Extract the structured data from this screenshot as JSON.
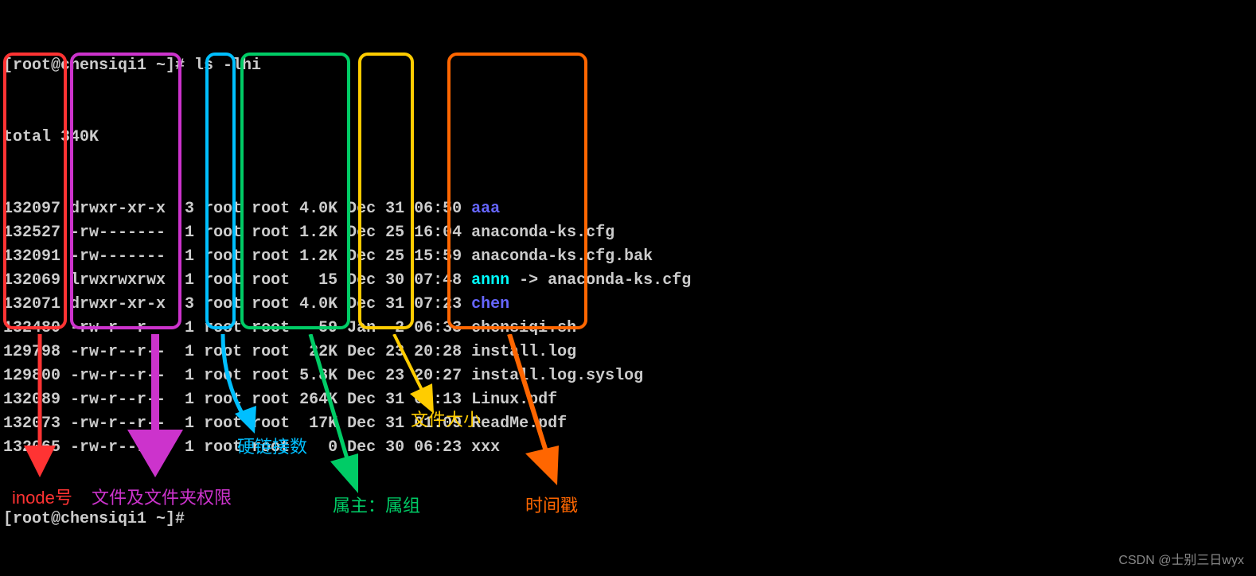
{
  "prompt1": "[root@chensiqi1 ~]# ls -lhi",
  "total": "total 340K",
  "prompt2": "[root@chensiqi1 ~]# ",
  "rows": [
    {
      "inode": "132097",
      "perm": "drwxr-xr-x",
      "links": "3",
      "owner": "root root",
      "size": "4.0K",
      "date": "Dec 31 06:50",
      "fname": "aaa",
      "class": "blue-dir",
      "extra": ""
    },
    {
      "inode": "132527",
      "perm": "-rw-------",
      "links": "1",
      "owner": "root root",
      "size": "1.2K",
      "date": "Dec 25 16:04",
      "fname": "anaconda-ks.cfg",
      "class": "fname",
      "extra": ""
    },
    {
      "inode": "132091",
      "perm": "-rw-------",
      "links": "1",
      "owner": "root root",
      "size": "1.2K",
      "date": "Dec 25 15:59",
      "fname": "anaconda-ks.cfg.bak",
      "class": "fname",
      "extra": ""
    },
    {
      "inode": "132069",
      "perm": "lrwxrwxrwx",
      "links": "1",
      "owner": "root root",
      "size": "  15",
      "date": "Dec 30 07:48",
      "fname": "annn",
      "class": "cyan-link",
      "extra": " -> anaconda-ks.cfg"
    },
    {
      "inode": "132071",
      "perm": "drwxr-xr-x",
      "links": "3",
      "owner": "root root",
      "size": "4.0K",
      "date": "Dec 31 07:23",
      "fname": "chen",
      "class": "blue-dir",
      "extra": ""
    },
    {
      "inode": "132480",
      "perm": "-rw-r--r--",
      "links": "1",
      "owner": "root root",
      "size": "  59",
      "date": "Jan  2 06:33",
      "fname": "chensiqi.sh",
      "class": "fname",
      "extra": ""
    },
    {
      "inode": "129798",
      "perm": "-rw-r--r--",
      "links": "1",
      "owner": "root root",
      "size": " 22K",
      "date": "Dec 23 20:28",
      "fname": "install.log",
      "class": "fname",
      "extra": ""
    },
    {
      "inode": "129800",
      "perm": "-rw-r--r--",
      "links": "1",
      "owner": "root root",
      "size": "5.8K",
      "date": "Dec 23 20:27",
      "fname": "install.log.syslog",
      "class": "fname",
      "extra": ""
    },
    {
      "inode": "132089",
      "perm": "-rw-r--r--",
      "links": "1",
      "owner": "root root",
      "size": "264K",
      "date": "Dec 31 07:13",
      "fname": "Linux.pdf",
      "class": "fname",
      "extra": ""
    },
    {
      "inode": "132073",
      "perm": "-rw-r--r--",
      "links": "1",
      "owner": "root root",
      "size": " 17K",
      "date": "Dec 31 01:09",
      "fname": "ReadMe.pdf",
      "class": "fname",
      "extra": ""
    },
    {
      "inode": "132065",
      "perm": "-rw-r--r--",
      "links": "1",
      "owner": "root root",
      "size": "   0",
      "date": "Dec 30 06:23",
      "fname": "xxx",
      "class": "fname",
      "extra": ""
    }
  ],
  "labels": {
    "inode": "inode号",
    "perm": "文件及文件夹权限",
    "links": "硬链接数",
    "owner": "属主：属组",
    "size": "文件大小",
    "date": "时间戳"
  },
  "watermark": "CSDN @士别三日wyx"
}
